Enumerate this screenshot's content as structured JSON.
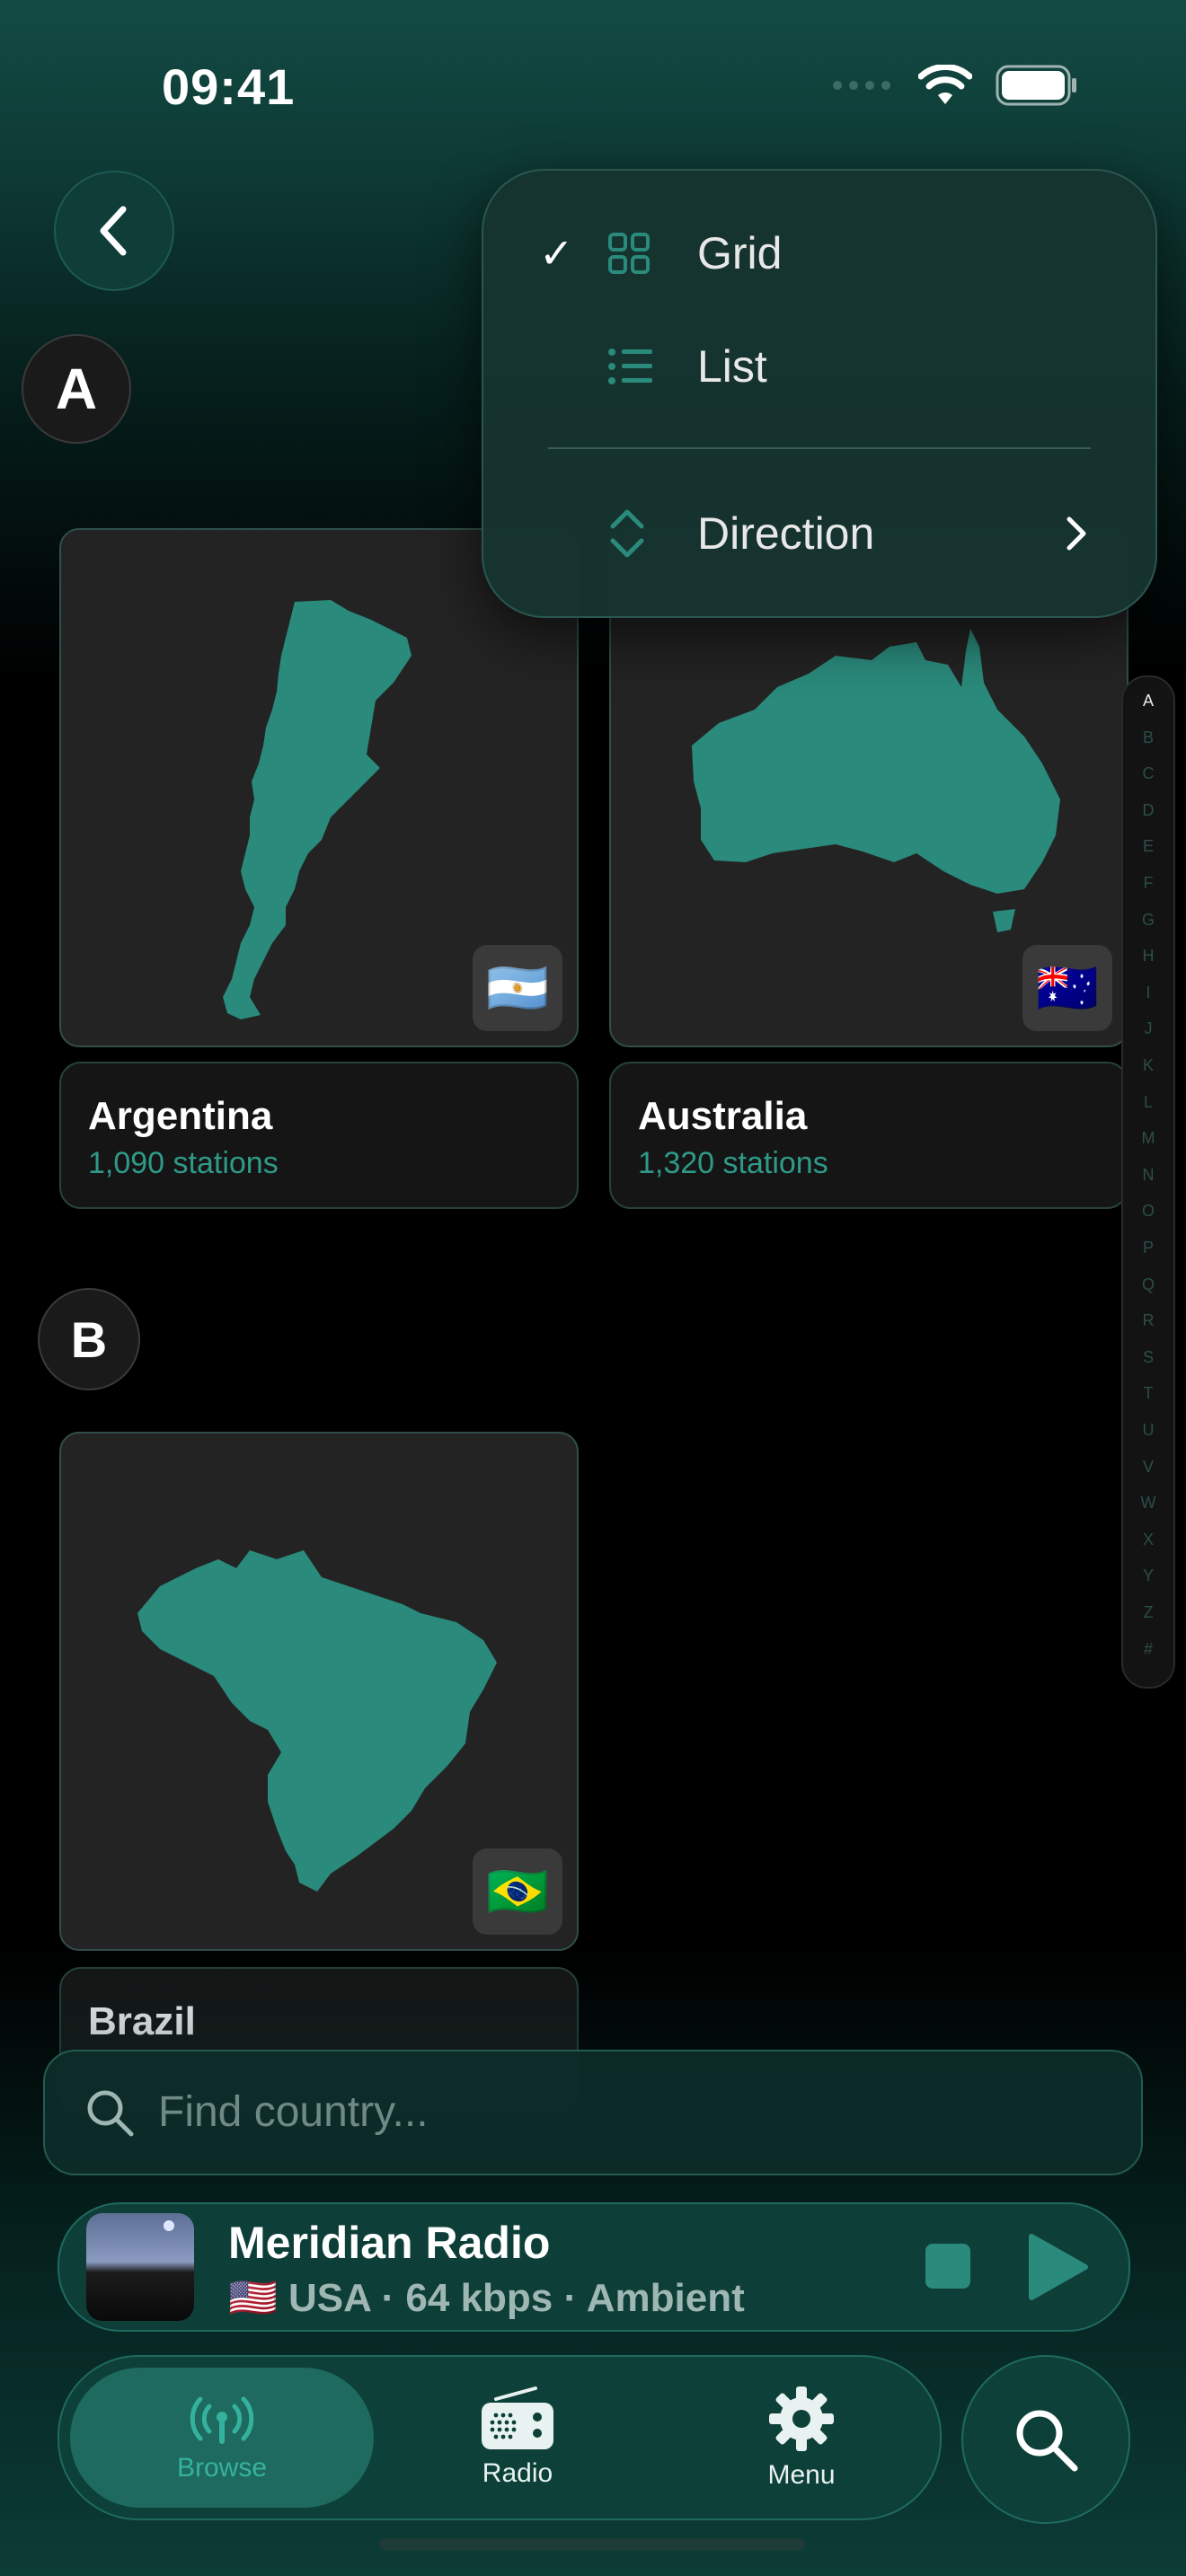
{
  "status": {
    "time": "09:41"
  },
  "sections": [
    {
      "letter": "A",
      "countries": [
        {
          "name": "Argentina",
          "stations": "1,090 stations",
          "flag": "🇦🇷"
        },
        {
          "name": "Australia",
          "stations": "1,320 stations",
          "flag": "🇦🇺"
        }
      ]
    },
    {
      "letter": "B",
      "countries": [
        {
          "name": "Brazil",
          "stations": "",
          "flag": "🇧🇷"
        }
      ]
    }
  ],
  "menu": {
    "items": [
      {
        "label": "Grid",
        "selected": true,
        "icon": "grid-icon"
      },
      {
        "label": "List",
        "selected": false,
        "icon": "list-icon"
      }
    ],
    "direction_label": "Direction",
    "checkmark": "✓"
  },
  "index_letters": [
    "A",
    "B",
    "C",
    "D",
    "E",
    "F",
    "G",
    "H",
    "I",
    "J",
    "K",
    "L",
    "M",
    "N",
    "O",
    "P",
    "Q",
    "R",
    "S",
    "T",
    "U",
    "V",
    "W",
    "X",
    "Y",
    "Z",
    "#"
  ],
  "search": {
    "placeholder": "Find country..."
  },
  "player": {
    "title": "Meridian Radio",
    "flag": "🇺🇸",
    "subtitle": "USA · 64 kbps · Ambient"
  },
  "tabs": [
    {
      "label": "Browse",
      "icon": "antenna-icon",
      "active": true
    },
    {
      "label": "Radio",
      "icon": "radio-icon",
      "active": false
    },
    {
      "label": "Menu",
      "icon": "gear-icon",
      "active": false
    }
  ],
  "colors": {
    "accent": "#2a8a7b",
    "background": "#000000",
    "menu_bg": "#163430"
  }
}
